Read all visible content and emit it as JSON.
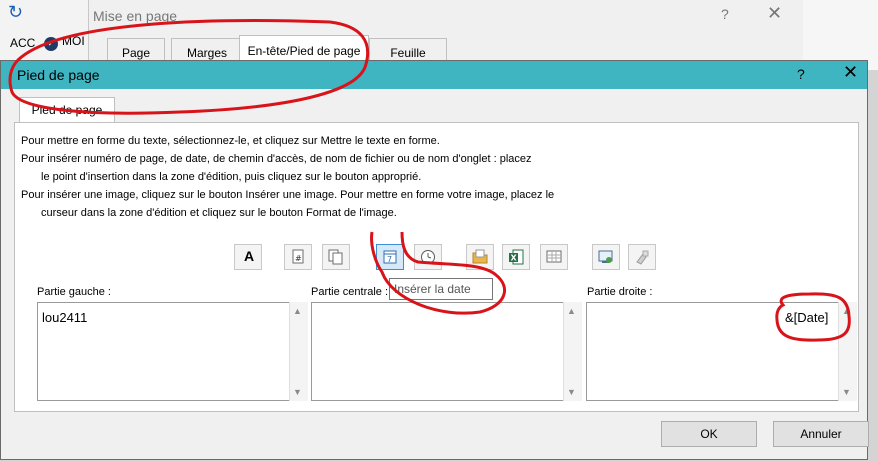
{
  "background_window": {
    "left_label": "ACC",
    "left_label2": "MOI",
    "refresh_glyph": "↻"
  },
  "parent_dialog": {
    "title": "Mise en page",
    "help_glyph": "?",
    "close_glyph": "✕",
    "tabs": [
      {
        "label": "Page",
        "selected": false
      },
      {
        "label": "Marges",
        "selected": false
      },
      {
        "label": "En-tête/Pied de page",
        "selected": true
      },
      {
        "label": "Feuille",
        "selected": false
      }
    ]
  },
  "dialog": {
    "title": "Pied de page",
    "help_glyph": "?",
    "close_glyph": "✕",
    "title_bar_color": "#3fb5c2",
    "tab_label": "Pied de page",
    "instructions": [
      "Pour mettre en forme du texte, sélectionnez-le, et cliquez sur Mettre le texte en forme.",
      "Pour insérer numéro de page, de date, de chemin d'accès, de nom de fichier ou de nom d'onglet  : placez",
      "le point d'insertion dans la zone d'édition, puis cliquez sur le bouton approprié.",
      "Pour insérer une image, cliquez sur le bouton Insérer une image. Pour mettre en forme votre image, placez le",
      "curseur dans la zone d'édition et cliquez sur le bouton Format de l'image."
    ],
    "toolbar": [
      {
        "icon": "format-text-icon",
        "glyph": "A"
      },
      {
        "icon": "page-number-icon",
        "glyph": "#"
      },
      {
        "icon": "page-count-icon",
        "glyph": "⧉"
      },
      {
        "icon": "insert-date-icon",
        "glyph": "7",
        "selected": true
      },
      {
        "icon": "insert-time-icon",
        "glyph": "◷"
      },
      {
        "icon": "file-path-icon",
        "glyph": ""
      },
      {
        "icon": "file-name-icon",
        "glyph": "X"
      },
      {
        "icon": "sheet-name-icon",
        "glyph": ""
      },
      {
        "icon": "insert-picture-icon",
        "glyph": ""
      },
      {
        "icon": "format-picture-icon",
        "glyph": ""
      }
    ],
    "tooltip": "Insérer la date",
    "sections": {
      "left": {
        "label": "Partie gauche :",
        "value": "lou2411"
      },
      "center": {
        "label": "Partie centrale :",
        "value": ""
      },
      "right": {
        "label": "Partie droite :",
        "value": "&[Date]"
      }
    },
    "ok_label": "OK",
    "cancel_label": "Annuler"
  },
  "annotation_color": "#d8141a"
}
